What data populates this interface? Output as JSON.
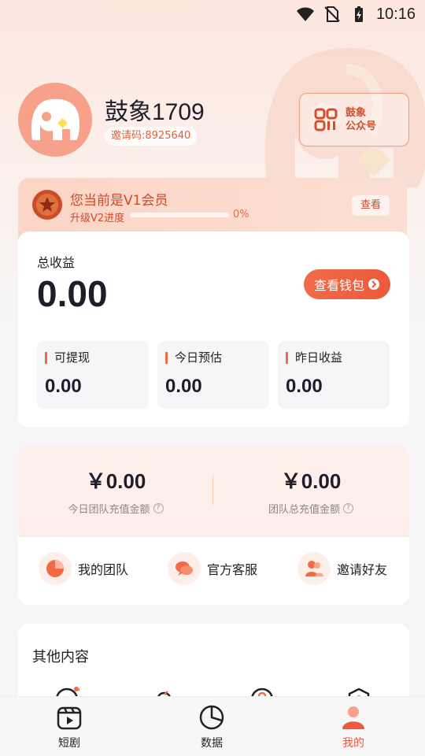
{
  "status_bar": {
    "time": "10:16"
  },
  "profile": {
    "name": "鼓象1709",
    "invite_code": "邀请码:8925640"
  },
  "official_account": {
    "line1": "鼓象",
    "line2": "公众号"
  },
  "membership": {
    "title": "您当前是V1会员",
    "progress_label": "升级V2进度",
    "progress_value": 0,
    "progress_text": "0%",
    "view_label": "查看"
  },
  "earnings": {
    "total_label": "总收益",
    "total_value": "0.00",
    "wallet_button": "查看钱包",
    "stats": [
      {
        "label": "可提现",
        "value": "0.00"
      },
      {
        "label": "今日预估",
        "value": "0.00"
      },
      {
        "label": "昨日收益",
        "value": "0.00"
      }
    ]
  },
  "team": {
    "today_amount": "￥0.00",
    "today_label": "今日团队充值金额",
    "total_amount": "￥0.00",
    "total_label": "团队总充值金额",
    "actions": [
      {
        "label": "我的团队",
        "icon": "pie-chart-icon"
      },
      {
        "label": "官方客服",
        "icon": "chat-bubbles-icon"
      },
      {
        "label": "邀请好友",
        "icon": "users-icon"
      }
    ]
  },
  "other": {
    "title": "其他内容"
  },
  "bottom_nav": [
    {
      "label": "短剧",
      "icon": "video-icon",
      "active": false
    },
    {
      "label": "数据",
      "icon": "pie-chart-icon",
      "active": false
    },
    {
      "label": "我的",
      "icon": "user-icon",
      "active": true
    }
  ],
  "colors": {
    "accent": "#ec5a3a",
    "accent_light": "#fdeee9",
    "text_dark": "#1e1e2a"
  }
}
